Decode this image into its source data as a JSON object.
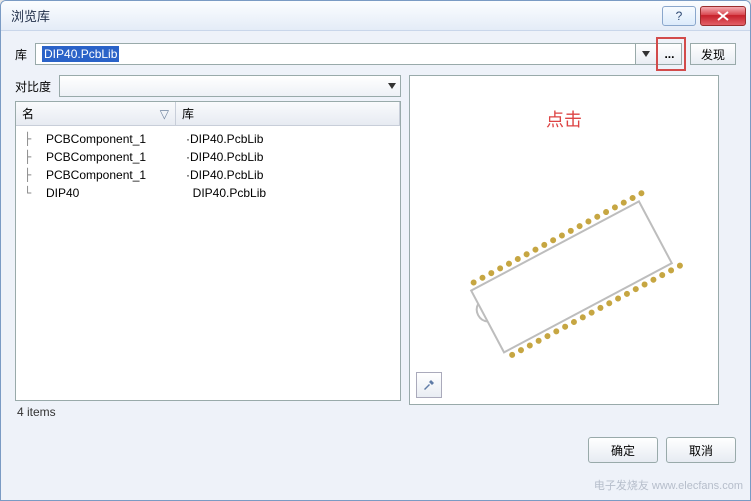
{
  "window": {
    "title": "浏览库",
    "help_label": "?",
    "close_label": "×"
  },
  "lib_row": {
    "label": "库",
    "value": "DIP40.PcbLib",
    "browse_label": "...",
    "discover_label": "发现"
  },
  "contrast": {
    "label": "对比度",
    "value": ""
  },
  "columns": {
    "name": "名",
    "lib": "库"
  },
  "tree": {
    "items": [
      {
        "name": "PCBComponent_1",
        "lib": "DIP40.PcbLib",
        "branch": "├ "
      },
      {
        "name": "PCBComponent_1",
        "lib": "DIP40.PcbLib",
        "branch": "├ "
      },
      {
        "name": "PCBComponent_1",
        "lib": "DIP40.PcbLib",
        "branch": "├ "
      },
      {
        "name": "DIP40",
        "lib": "DIP40.PcbLib",
        "branch": "└ "
      }
    ]
  },
  "count_text": "4 items",
  "annotation": "点击",
  "footer": {
    "ok": "确定",
    "cancel": "取消"
  },
  "watermark": "电子发烧友 www.elecfans.com"
}
